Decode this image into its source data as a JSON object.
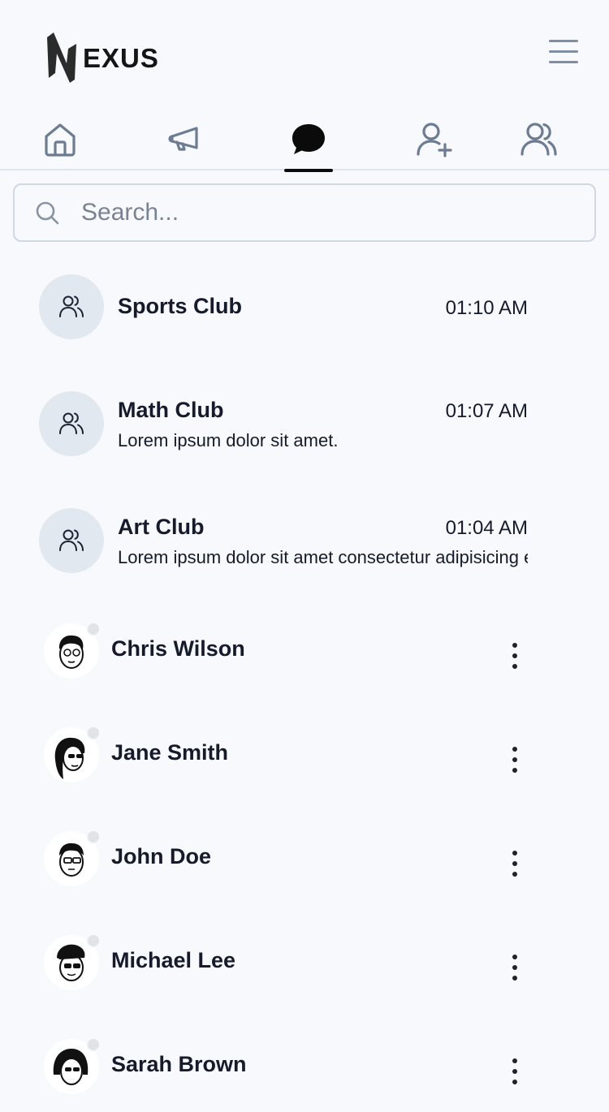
{
  "app": {
    "logo_text": "EXUS"
  },
  "tabs": [
    {
      "icon": "home-icon"
    },
    {
      "icon": "megaphone-icon"
    },
    {
      "icon": "chat-icon",
      "active": true
    },
    {
      "icon": "add-user-icon"
    },
    {
      "icon": "users-icon"
    }
  ],
  "search": {
    "placeholder": "Search..."
  },
  "groups": [
    {
      "name": "Sports Club",
      "time": "01:10 AM",
      "message": ""
    },
    {
      "name": "Math Club",
      "time": "01:07 AM",
      "message": "Lorem ipsum dolor sit amet."
    },
    {
      "name": "Art Club",
      "time": "01:04 AM",
      "message": "Lorem ipsum dolor sit amet consectetur adipisicing elit."
    }
  ],
  "contacts": [
    {
      "name": "Chris Wilson",
      "status": "offline"
    },
    {
      "name": "Jane Smith",
      "status": "offline"
    },
    {
      "name": "John Doe",
      "status": "offline"
    },
    {
      "name": "Michael Lee",
      "status": "offline"
    },
    {
      "name": "Sarah Brown",
      "status": "offline"
    }
  ],
  "colors": {
    "accent": "#0b0b0b",
    "icon_gray": "#6b7c93",
    "avatar_bg": "#e2e8f0",
    "status_offline": "#e1e3e6"
  }
}
